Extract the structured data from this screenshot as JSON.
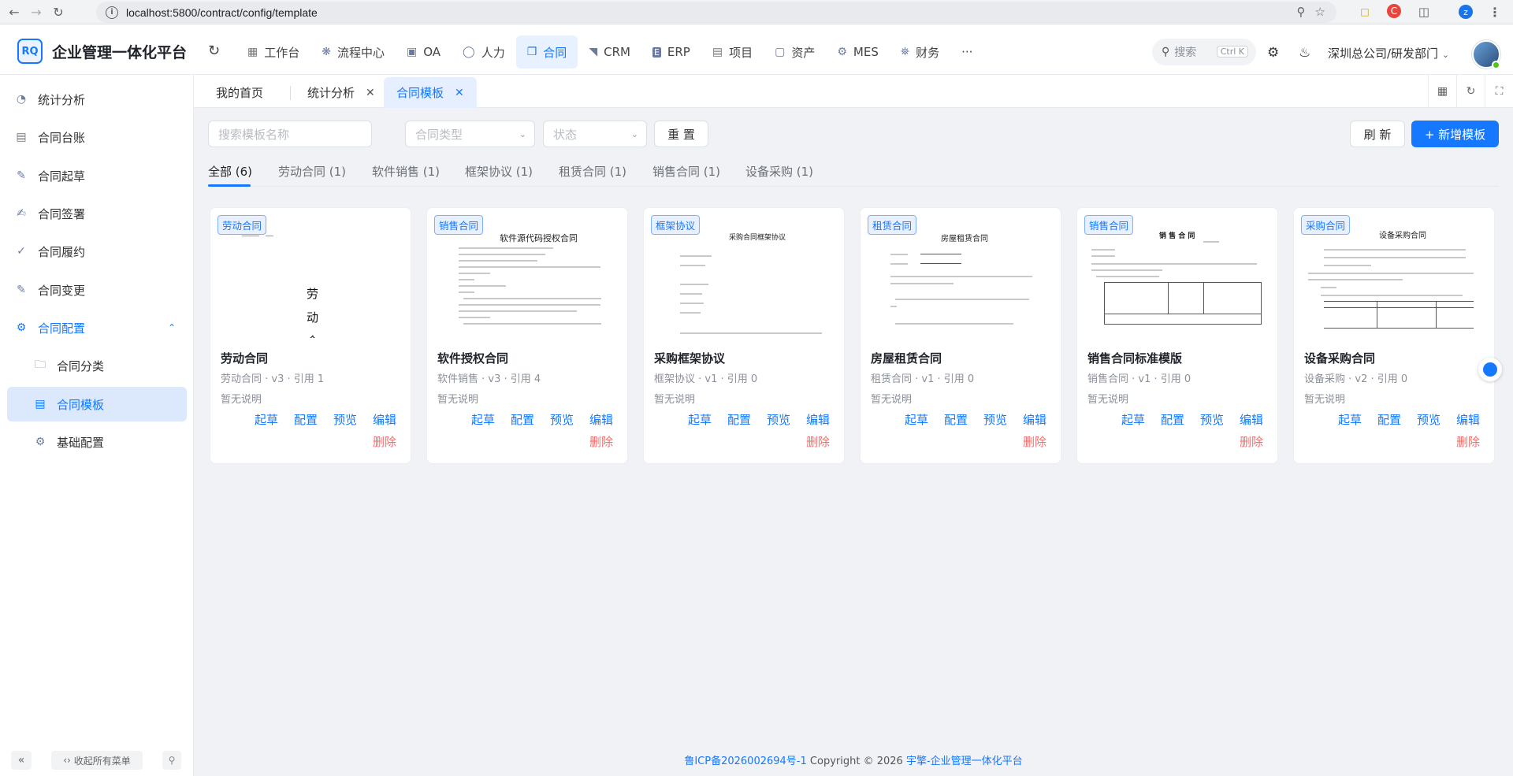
{
  "browser": {
    "url": "localhost:5800/contract/config/template",
    "profile_letter": "z"
  },
  "header": {
    "logo_text": "RQ",
    "app_title": "企业管理一体化平台",
    "nav": [
      {
        "label": "工作台",
        "icon": "dashboard-icon"
      },
      {
        "label": "流程中心",
        "icon": "workflow-icon"
      },
      {
        "label": "OA",
        "icon": "oa-icon"
      },
      {
        "label": "人力",
        "icon": "people-icon"
      },
      {
        "label": "合同",
        "icon": "contract-icon",
        "active": true
      },
      {
        "label": "CRM",
        "icon": "crm-icon"
      },
      {
        "label": "ERP",
        "icon": "erp-icon"
      },
      {
        "label": "项目",
        "icon": "project-icon"
      },
      {
        "label": "资产",
        "icon": "asset-icon"
      },
      {
        "label": "MES",
        "icon": "mes-icon"
      },
      {
        "label": "财务",
        "icon": "finance-icon"
      },
      {
        "label": "···",
        "icon": "more-icon"
      }
    ],
    "search_placeholder": "搜索",
    "search_shortcut": "Ctrl K",
    "org": "深圳总公司/研发部门"
  },
  "sidebar": {
    "items": [
      {
        "label": "统计分析",
        "icon": "stats-icon"
      },
      {
        "label": "合同台账",
        "icon": "ledger-icon"
      },
      {
        "label": "合同起草",
        "icon": "draft-icon"
      },
      {
        "label": "合同签署",
        "icon": "sign-icon"
      },
      {
        "label": "合同履约",
        "icon": "perform-icon"
      },
      {
        "label": "合同变更",
        "icon": "change-icon"
      },
      {
        "label": "合同配置",
        "icon": "config-icon"
      },
      {
        "label": "合同分类",
        "icon": "folder-icon"
      },
      {
        "label": "合同模板",
        "icon": "template-icon"
      },
      {
        "label": "基础配置",
        "icon": "gear-icon"
      }
    ],
    "fold_all": "收起所有菜单"
  },
  "tabs": [
    {
      "label": "我的首页"
    },
    {
      "label": "统计分析",
      "closable": true
    },
    {
      "label": "合同模板",
      "closable": true,
      "active": true
    }
  ],
  "filters": {
    "name_placeholder": "搜索模板名称",
    "type_placeholder": "合同类型",
    "status_placeholder": "状态",
    "reset": "重 置",
    "refresh": "刷 新",
    "add": "+ 新增模板"
  },
  "category_tabs": [
    "全部 (6)",
    "劳动合同 (1)",
    "软件销售 (1)",
    "框架协议 (1)",
    "租赁合同 (1)",
    "销售合同 (1)",
    "设备采购 (1)"
  ],
  "cards": [
    {
      "badge": "劳动合同",
      "title": "劳动合同",
      "meta": "劳动合同 · v3 · 引用 1",
      "desc": "暂无说明",
      "doc_title": "劳\n动\n合"
    },
    {
      "badge": "销售合同",
      "title": "软件授权合同",
      "meta": "软件销售 · v3 · 引用 4",
      "desc": "暂无说明",
      "doc_title": "软件源代码授权合同"
    },
    {
      "badge": "框架协议",
      "title": "采购框架协议",
      "meta": "框架协议 · v1 · 引用 0",
      "desc": "暂无说明",
      "doc_title": "采购合同框架协议"
    },
    {
      "badge": "租赁合同",
      "title": "房屋租赁合同",
      "meta": "租赁合同 · v1 · 引用 0",
      "desc": "暂无说明",
      "doc_title": "房屋租赁合同"
    },
    {
      "badge": "销售合同",
      "title": "销售合同标准模版",
      "meta": "销售合同 · v1 · 引用 0",
      "desc": "暂无说明",
      "doc_title": "销 售 合 同"
    },
    {
      "badge": "采购合同",
      "title": "设备采购合同",
      "meta": "设备采购 · v2 · 引用 0",
      "desc": "暂无说明",
      "doc_title": "设备采购合同"
    }
  ],
  "card_actions": {
    "draft": "起草",
    "config": "配置",
    "preview": "预览",
    "edit": "编辑",
    "delete": "删除"
  },
  "footer": {
    "icp": "鲁ICP备2026002694号-1",
    "copyright": "Copyright © 2026",
    "brand": "宇擎-企业管理一体化平台"
  },
  "colors": {
    "primary": "#1677ff",
    "danger": "#f56c6c",
    "active_bg": "#dce9fd"
  }
}
